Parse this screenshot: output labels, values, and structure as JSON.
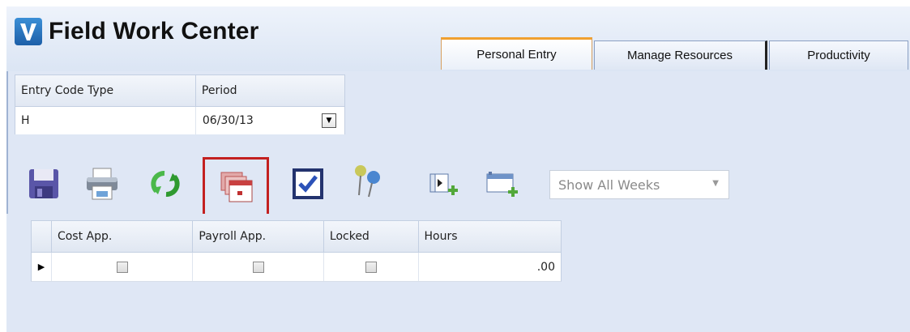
{
  "app": {
    "title": "Field Work Center",
    "logo_letter": "V"
  },
  "tabs": [
    {
      "label": "Personal Entry",
      "active": true
    },
    {
      "label": "Manage Resources",
      "active": false
    },
    {
      "label": "Productivity",
      "active": false
    }
  ],
  "filters": {
    "headers": [
      "Entry Code Type",
      "Period"
    ],
    "entry_code_type": "H",
    "period": "06/30/13"
  },
  "toolbar": {
    "icons": [
      "save-icon",
      "print-icon",
      "refresh-icon",
      "calendar-icon",
      "checkmark-icon",
      "pushpin-icon",
      "add-column-icon",
      "add-row-icon"
    ],
    "highlighted": "calendar-icon",
    "weeks_select": {
      "value": "Show All Weeks"
    }
  },
  "grid": {
    "columns": [
      "Cost App.",
      "Payroll App.",
      "Locked",
      "Hours"
    ],
    "rows": [
      {
        "cost_app": false,
        "payroll_app": false,
        "locked": false,
        "hours": ".00"
      }
    ]
  },
  "colors": {
    "accent_tab": "#f0a030",
    "highlight_border": "#c32020",
    "panel_bg": "#dfe7f5"
  }
}
